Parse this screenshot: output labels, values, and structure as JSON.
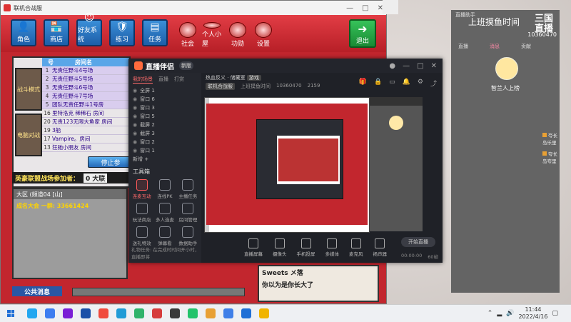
{
  "game": {
    "title": "联机合战服",
    "toolbar": {
      "buttons": [
        "角色",
        "商店",
        "好友系统",
        "练习",
        "任务"
      ],
      "round_buttons": [
        "社会",
        "个人小屋",
        "功勋",
        "设置"
      ],
      "exit_label": "退出"
    },
    "rooms": {
      "header": [
        "号",
        "房间名"
      ],
      "thumbs": [
        "战斗模式",
        "电脑对战"
      ],
      "rows": [
        {
          "n": "1",
          "name": "无责任野斗4号场"
        },
        {
          "n": "2",
          "name": "无责任野斗5号场"
        },
        {
          "n": "3",
          "name": "无责任野斗6号场"
        },
        {
          "n": "4",
          "name": "无责任野斗7号场"
        },
        {
          "n": "5",
          "name": "团队无责任野斗1号房"
        },
        {
          "n": "16",
          "name": "里特洛克 稀稀石 房间"
        },
        {
          "n": "20",
          "name": "无责123无限大鱼家 房间"
        },
        {
          "n": "19",
          "name": "3船"
        },
        {
          "n": "17",
          "name": "Vampire。房间"
        },
        {
          "n": "13",
          "name": "狂驰小朋友 房间"
        }
      ]
    },
    "stop_label": "停止参",
    "league_label": "英豪联盟战场参加者：",
    "league_btn": "0 大联",
    "area": "大区 (频道04 [山]",
    "gold_line": "成名大会 一群: 33661424",
    "public_msg": "公共消息",
    "chat": [
      "Sweets メ落",
      "你以为是你长大了"
    ]
  },
  "stream": {
    "app_name": "直播伴侣",
    "version": "新版",
    "tabs": [
      "我的场景",
      "直播",
      "打赏"
    ],
    "scenes": [
      "全屏 1",
      "窗口 6",
      "窗口 3",
      "窗口 5",
      "截屏 2",
      "截屏 3",
      "窗口 2",
      "窗口 1"
    ],
    "add_scene": "新增 +",
    "tools_title": "工具箱",
    "tools": [
      {
        "label": "连麦互动",
        "active": true
      },
      {
        "label": "连线PK",
        "active": false
      },
      {
        "label": "主播任务",
        "active": false
      },
      {
        "label": "玩法商店",
        "active": false
      },
      {
        "label": "多人连麦",
        "active": false
      },
      {
        "label": "房间管理",
        "active": false
      },
      {
        "label": "送礼特效",
        "active": false
      },
      {
        "label": "弹幕看",
        "active": false
      },
      {
        "label": "数据助手",
        "active": false
      }
    ],
    "status_left": "礼物任务: 在完成时时间开小时，直播即将",
    "info": {
      "title": "热血反义 · 储藏室",
      "tag": "游戏",
      "r2a": "联机合战服",
      "r2b": "上班摸鱼时间",
      "uid": "10360470",
      "fans": "2159"
    },
    "controls": [
      "直播屏幕",
      "摄像头",
      "手机投屏",
      "多媒体",
      "麦克风",
      "扬声器"
    ],
    "go_live": "开始直播",
    "status_right": [
      "00:00:00",
      "60帧"
    ]
  },
  "overlay": {
    "title_small": "直播助手",
    "heading": "上班摸鱼时间",
    "logo": "三国 直播",
    "count": "10360470",
    "tabs": [
      "直播",
      "消息",
      "贡献"
    ],
    "caption": "智兰人上榜",
    "messages": [
      "夸长岛乐里",
      "夸长岛夸里"
    ]
  },
  "taskbar": {
    "apps": [
      "#22a7f0",
      "#3c7df0",
      "#7a1fd6",
      "#1a4fa8",
      "#f04a3c",
      "#1f9bd6",
      "#2fb36b",
      "#d63c3c",
      "#3a3a3a",
      "#22c36b",
      "#e8a034",
      "#3f7fe8",
      "#1f6fd6",
      "#f0b400"
    ],
    "time": "11:44",
    "date": "2022/4/16"
  }
}
